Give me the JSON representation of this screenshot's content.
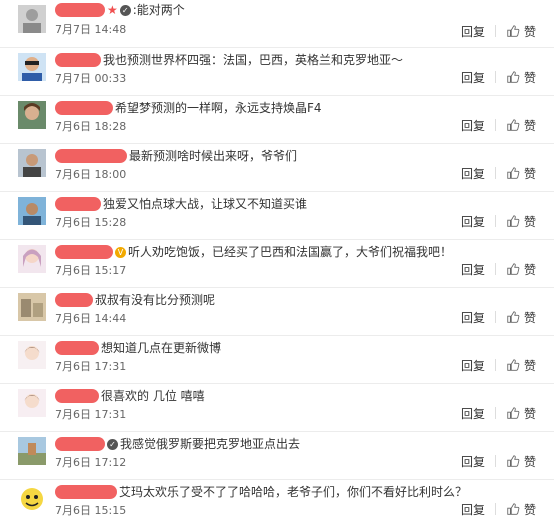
{
  "labels": {
    "reply": "回复",
    "like": "赞"
  },
  "comments": [
    {
      "text": ":能对两个",
      "date": "7月7日 14:48"
    },
    {
      "text": "我也预测世界杯四强：法国，巴西，英格兰和克罗地亚～",
      "date": "7月7日 00:33"
    },
    {
      "text": "希望梦预测的一样啊，永远支持焕晶F4",
      "date": "7月6日 18:28"
    },
    {
      "text": "最新预测啥时候出来呀，爷爷们",
      "date": "7月6日 18:00"
    },
    {
      "text": "独爱又怕点球大战，让球又不知道买谁",
      "date": "7月6日 15:28"
    },
    {
      "text": "听人劝吃饱饭，已经买了巴西和法国赢了，大爷们祝福我吧！",
      "date": "7月6日 15:17"
    },
    {
      "text": "叔叔有没有比分预测呢",
      "date": "7月6日 14:44"
    },
    {
      "text": "想知道几点在更新微博",
      "date": "7月6日 17:31"
    },
    {
      "text": "很喜欢的 几位 嘻嘻",
      "date": "7月6日 17:31"
    },
    {
      "text": "我感觉俄罗斯要把克罗地亚点出去",
      "date": "7月6日 17:12"
    },
    {
      "text": "艾玛太欢乐了受不了了哈哈哈，老爷子们，你们不看好比利时么？",
      "date": "7月6日 15:15"
    }
  ],
  "colors": {
    "redaction": "#f05050",
    "text": "#333333",
    "date": "#666666",
    "divider": "#ececec"
  },
  "icons": {
    "like": "thumbs-up-icon",
    "vip": "vip-badge-icon"
  }
}
